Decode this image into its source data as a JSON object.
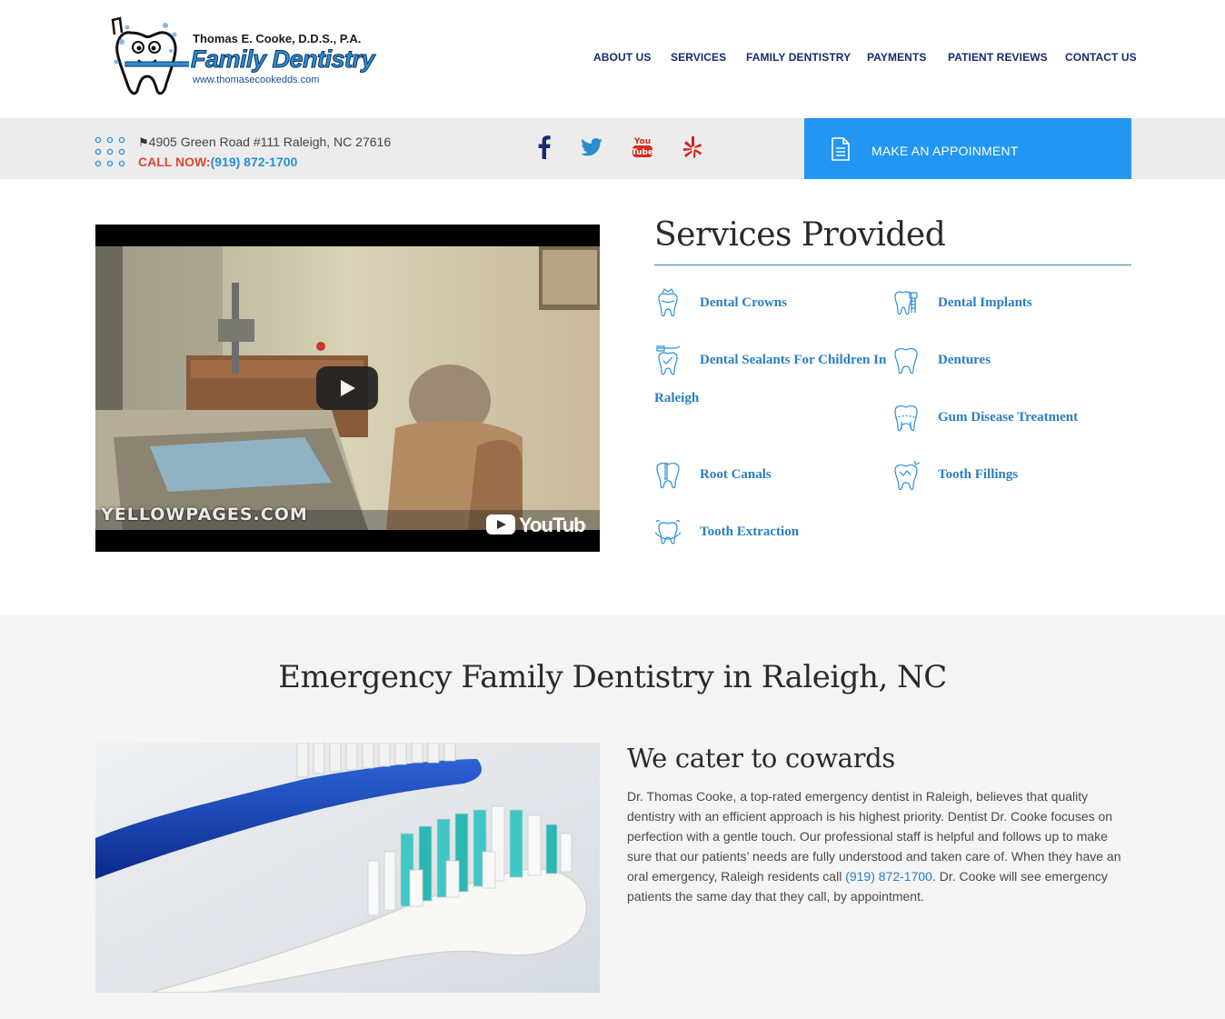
{
  "header": {
    "logo": {
      "line1": "Thomas E. Cooke, D.D.S., P.A.",
      "line2": "Family Dentistry",
      "line3": "www.thomasecookedds.com"
    },
    "nav": [
      {
        "label": "ABOUT US"
      },
      {
        "label": "SERVICES"
      },
      {
        "label": "FAMILY DENTISTRY"
      },
      {
        "label": "PAYMENTS"
      },
      {
        "label": "PATIENT REVIEWS"
      },
      {
        "label": "CONTACT US"
      }
    ]
  },
  "infobar": {
    "address": "4905 Green Road #111 Raleigh, NC 27616",
    "call_label": "CALL NOW:",
    "call_number": "(919) 872-1700",
    "social": [
      "facebook-icon",
      "twitter-icon",
      "youtube-icon",
      "yelp-icon"
    ],
    "appointment_label": "MAKE AN APPOINMENT"
  },
  "video": {
    "watermark": "YELLOWPAGES.COM",
    "brand": "YouTube"
  },
  "services": {
    "title": "Services Provided",
    "items": [
      {
        "label": "Dental Crowns",
        "icon": "crown-tooth-icon"
      },
      {
        "label": "Dental Implants",
        "icon": "implant-tooth-icon"
      },
      {
        "label": "Dental Sealants For Children In",
        "icon": "sealant-tooth-icon"
      },
      {
        "label": "Raleigh",
        "icon": ""
      },
      {
        "label": "Dentures",
        "icon": "denture-tooth-icon"
      },
      {
        "label": "Gum Disease Treatment",
        "icon": "gum-tooth-icon"
      },
      {
        "label": "Root Canals",
        "icon": "root-canal-tooth-icon"
      },
      {
        "label": "Tooth Fillings",
        "icon": "filling-tooth-icon"
      },
      {
        "label": "Tooth Extraction",
        "icon": "extraction-tooth-icon"
      }
    ]
  },
  "emergency": {
    "title": "Emergency Family Dentistry in Raleigh, NC",
    "subtitle": "We cater to cowards",
    "body_before": "Dr. Thomas Cooke, a top-rated emergency dentist in Raleigh, believes that quality dentistry with an efficient approach is his highest priority. Dentist Dr. Cooke focuses on perfection with a gentle touch. Our professional staff is helpful and follows up to make sure that our patients’ needs are fully understood and taken care of. When they have an oral emergency, Raleigh residents call ",
    "body_phone": "(919) 872-1700",
    "body_after": ". Dr. Cooke will see emergency patients the same day that they call, by appointment."
  },
  "colors": {
    "accent_blue": "#2196f3",
    "nav_text": "#1a2a6c",
    "call_now_red": "#e2452c",
    "service_link": "#2a7ec4"
  }
}
